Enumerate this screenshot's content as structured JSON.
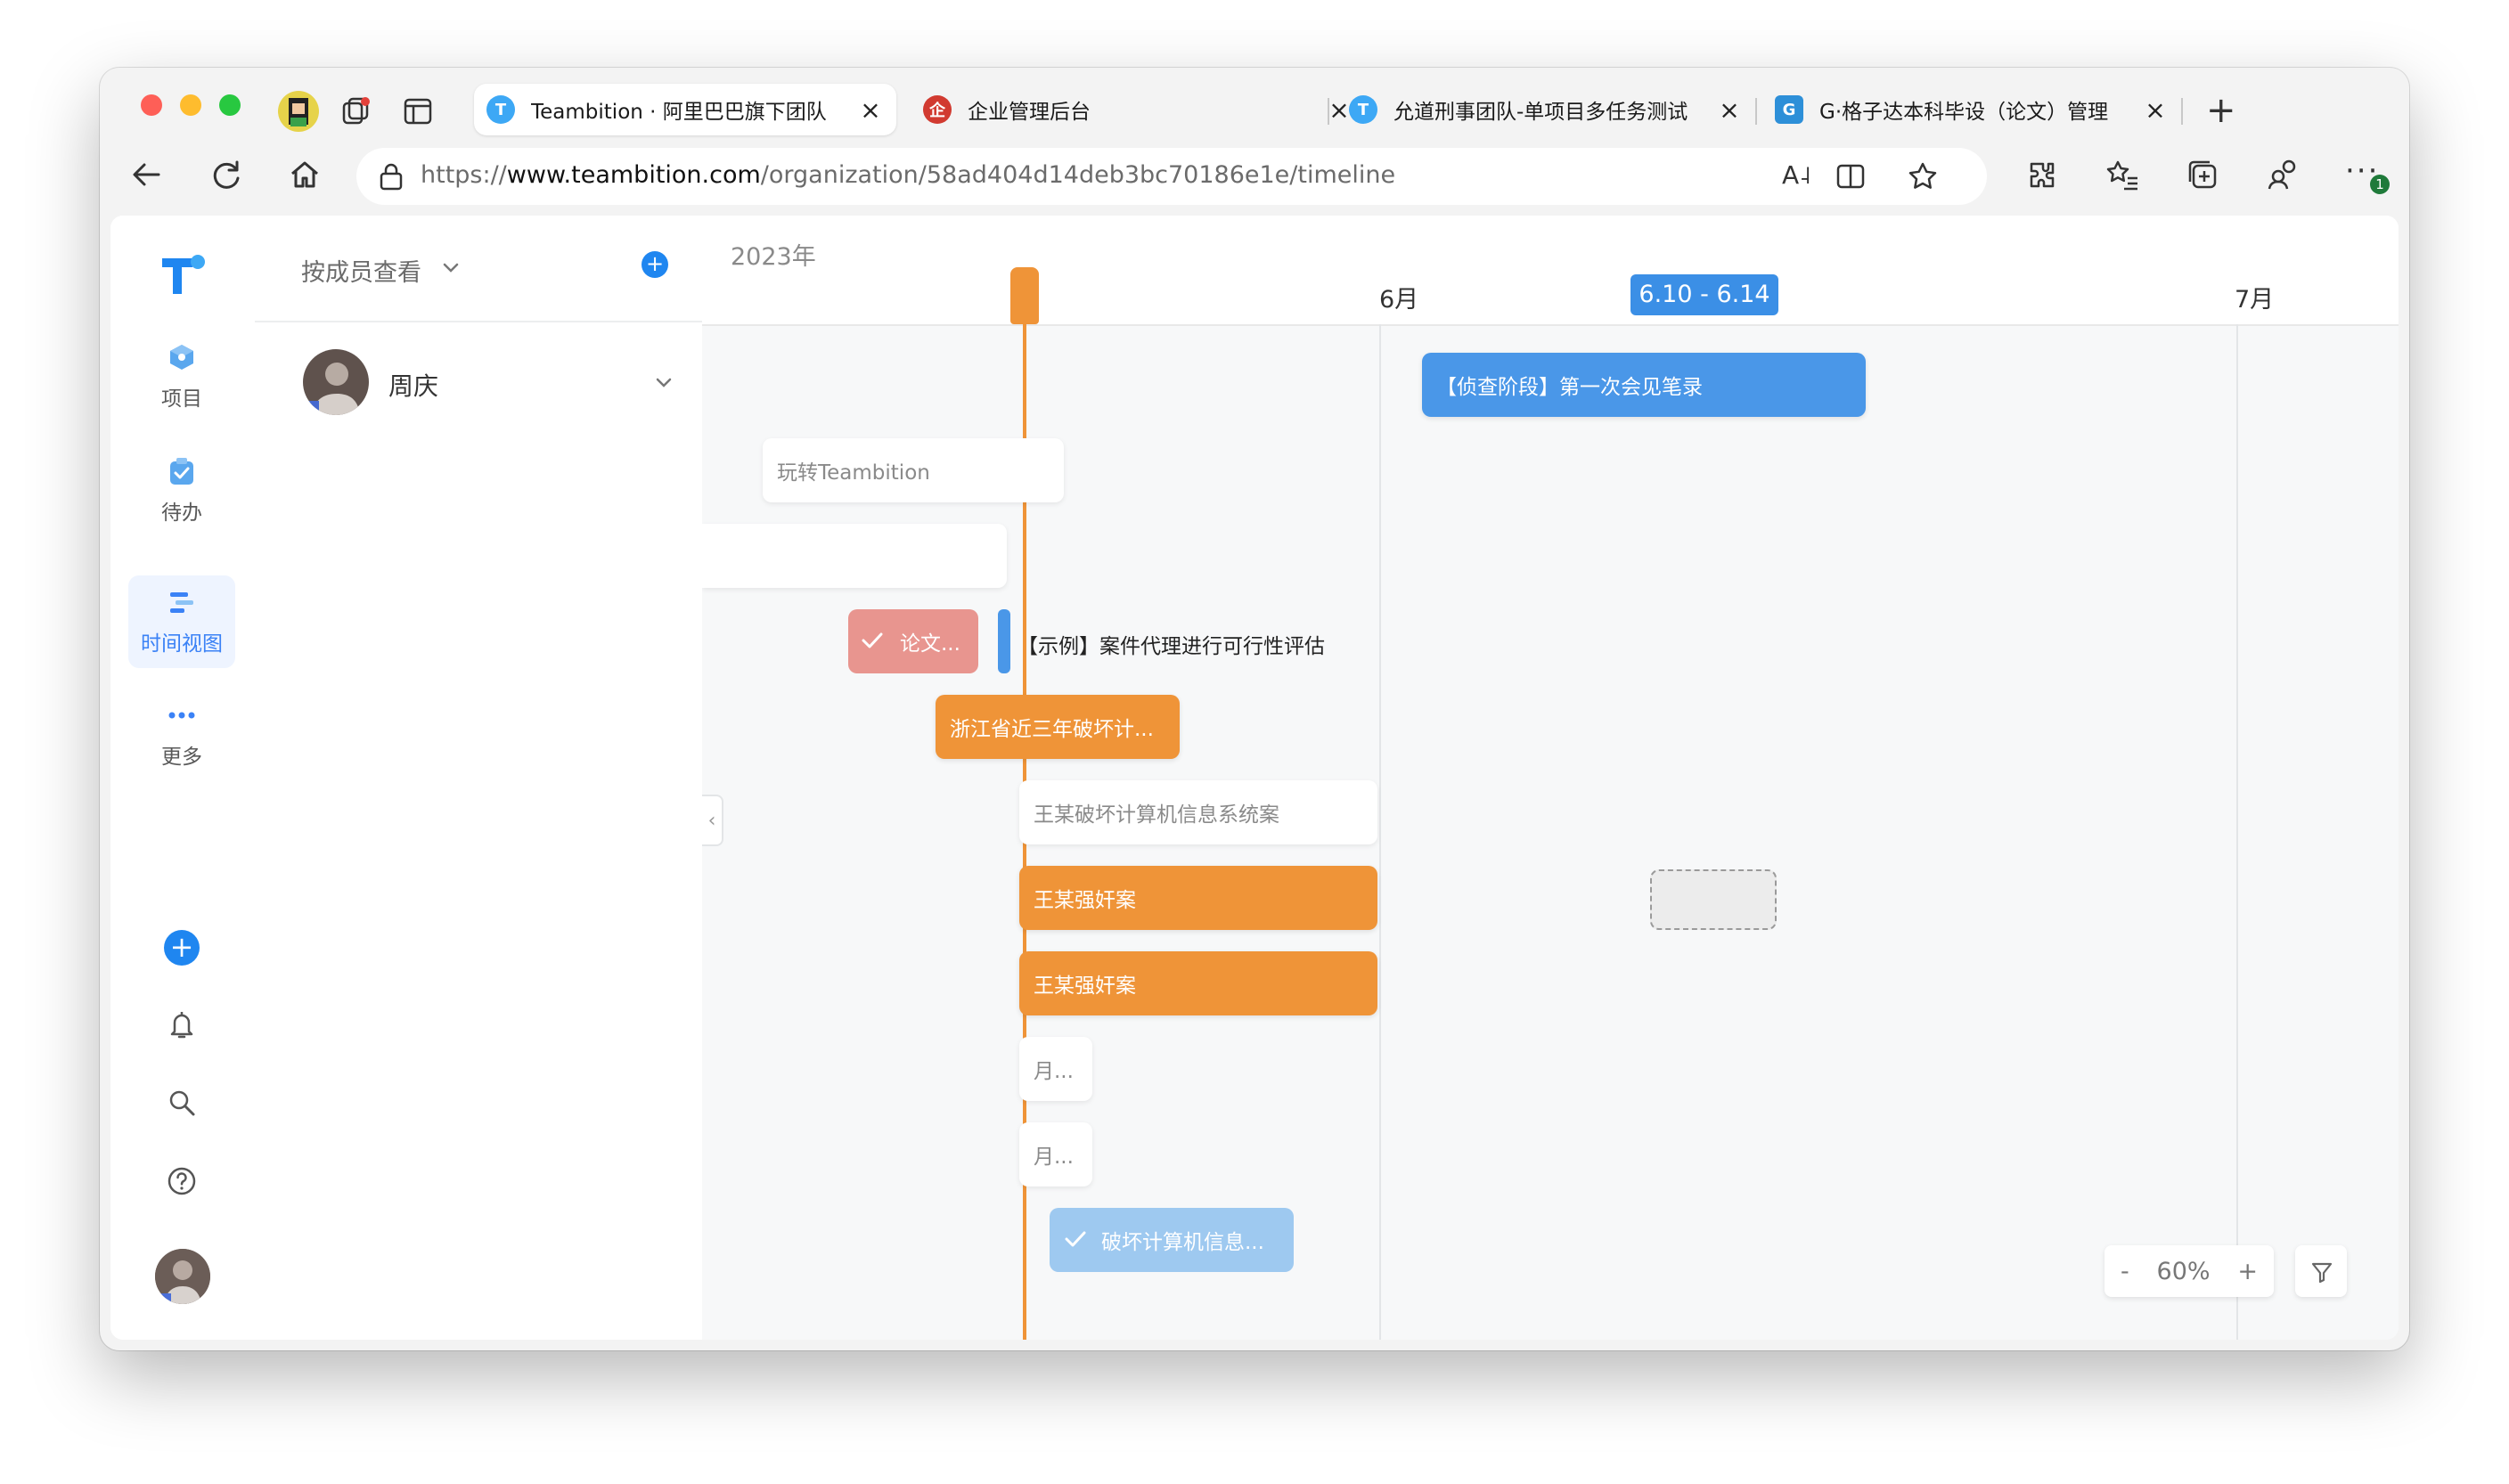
{
  "browser": {
    "tabs": [
      {
        "title": "Teambition · 阿里巴巴旗下团队",
        "active": true
      },
      {
        "title": "企业管理后台",
        "active": false
      },
      {
        "title": "允道刑事团队-单项目多任务测试",
        "active": false
      },
      {
        "title": "G·格子达本科毕设（论文）管理",
        "active": false
      }
    ],
    "url_prefix": "https://",
    "url_domain": "www.teambition.com",
    "url_path": "/organization/58ad404d14deb3bc70186e1e/timeline",
    "extension_badge": "1"
  },
  "nav": {
    "items": [
      {
        "label": "项目",
        "icon": "cube-icon"
      },
      {
        "label": "待办",
        "icon": "clipboard-check-icon"
      },
      {
        "label": "时间视图",
        "icon": "timeline-icon",
        "active": true
      },
      {
        "label": "更多",
        "icon": "more-dots-icon"
      }
    ]
  },
  "member_panel": {
    "view_selector": "按成员查看",
    "members": [
      {
        "name": "周庆"
      }
    ]
  },
  "timeline": {
    "year": "2023年",
    "months": [
      "6月",
      "7月"
    ],
    "highlight_range": "6.10 - 6.14",
    "zoom": "60%",
    "zoom_minus": "-",
    "zoom_plus": "+",
    "tasks": [
      {
        "title": "【侦查阶段】第一次会见笔录",
        "color": "#4a97e8"
      },
      {
        "title": "玩转Teambition",
        "color": "#ffffff"
      },
      {
        "title": "",
        "color": "#ffffff"
      },
      {
        "title": "论文...",
        "color": "#e8958f",
        "done": true
      },
      {
        "title": "【示例】案件代理进行可行性评估",
        "color": "#4a97e8"
      },
      {
        "title": "浙江省近三年破坏计...",
        "color": "#ef9438"
      },
      {
        "title": "王某破坏计算机信息系统案",
        "color": "#ffffff"
      },
      {
        "title": "王某强奸案",
        "color": "#ef9438"
      },
      {
        "title": "王某强奸案",
        "color": "#ef9438"
      },
      {
        "title": "月...",
        "color": "#ffffff"
      },
      {
        "title": "月...",
        "color": "#ffffff"
      },
      {
        "title": "破坏计算机信息...",
        "color": "#9ec9f0",
        "done": true
      }
    ]
  },
  "colors": {
    "today_line": "#ef9438",
    "accent": "#3b82f6"
  }
}
